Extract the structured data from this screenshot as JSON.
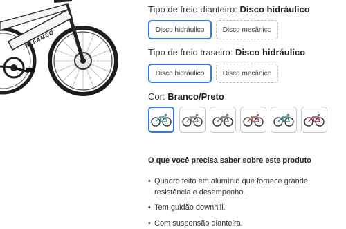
{
  "front_brake": {
    "label": "Tipo de freio dianteiro:",
    "selected_value": "Disco hidráulico",
    "options": [
      "Disco hidráulico",
      "Disco mecânico"
    ]
  },
  "rear_brake": {
    "label": "Tipo de freio traseiro:",
    "selected_value": "Disco hidráulico",
    "options": [
      "Disco hidráulico",
      "Disco mecânico"
    ]
  },
  "color": {
    "label": "Cor:",
    "selected_value": "Branco/Preto",
    "swatch_accents": [
      "#4aa3a3",
      "#888888",
      "#777777",
      "#b05050",
      "#3a8a8a",
      "#b03060"
    ]
  },
  "product_info": {
    "title": "O que você precisa saber sobre este produto",
    "bullets": [
      "Quadro feito em alumínio que fornece grande resistência e desempenho.",
      "Tem guidão downhill.",
      "Com suspensão dianteira."
    ]
  },
  "image_text": {
    "frame_brand": "ALFAMEQ"
  }
}
